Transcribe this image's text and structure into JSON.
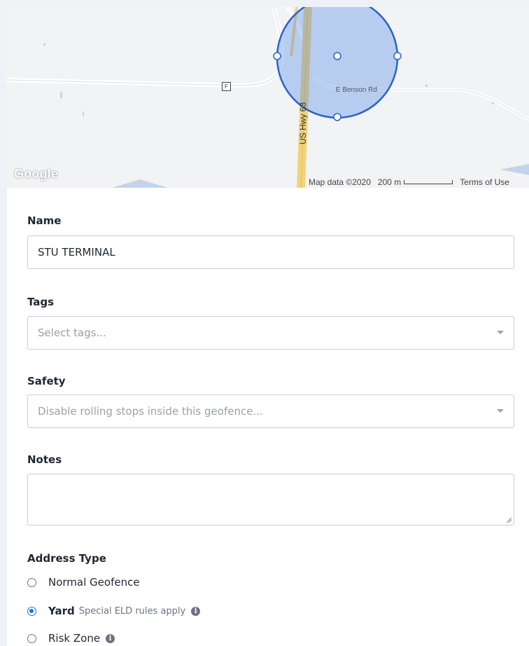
{
  "map": {
    "logo": "Google",
    "attribution": "Map data ©2020",
    "scale_label": "200 m",
    "terms": "Terms of Use",
    "highway_label": "US Hwy 63",
    "road_label": "E Benson Rd",
    "route_shield": "F",
    "geofence_color": "#4a86e8"
  },
  "form": {
    "name": {
      "label": "Name",
      "value": "STU TERMINAL"
    },
    "tags": {
      "label": "Tags",
      "placeholder": "Select tags..."
    },
    "safety": {
      "label": "Safety",
      "placeholder": "Disable rolling stops inside this geofence..."
    },
    "notes": {
      "label": "Notes",
      "value": ""
    },
    "address_type": {
      "label": "Address Type",
      "options": [
        {
          "label": "Normal Geofence",
          "hint": "",
          "selected": false
        },
        {
          "label": "Yard",
          "hint": "Special ELD rules apply",
          "selected": true
        },
        {
          "label": "Risk Zone",
          "hint": "",
          "selected": false
        }
      ]
    }
  }
}
